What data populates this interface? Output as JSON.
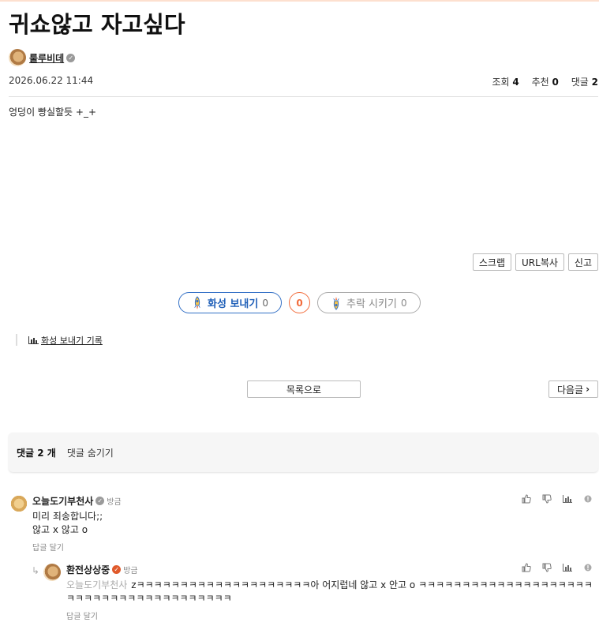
{
  "post": {
    "title": "귀쇼않고 자고싶다",
    "author": "룰루비데",
    "date": "2026.06.22 11:44",
    "stats": {
      "views_label": "조회",
      "views": "4",
      "recommend_label": "추천",
      "recommend": "0",
      "comments_label": "댓글",
      "comments": "2"
    },
    "body": "엉덩이 빵실할듯 +_+"
  },
  "tools": {
    "scrap": "스크랩",
    "copy_url": "URL복사",
    "report": "신고"
  },
  "vote": {
    "up_label": "화성 보내기",
    "up_count": "0",
    "score": "0",
    "down_label": "추락 시키기",
    "down_count": "0",
    "history_label": "화성 보내기 기록"
  },
  "nav": {
    "list_label": "목록으로",
    "next_label": "다음글"
  },
  "comment_bar": {
    "count_label": "댓글 2 개",
    "hide_label": "댓글 숨기기"
  },
  "comments": [
    {
      "author": "오늘도기부천사",
      "time": "방금",
      "lines": [
        "미리 죄송합니다;;",
        "않고 x 않고 o"
      ],
      "reply_label": "답글 달기"
    },
    {
      "author": "환전상상중",
      "time": "방금",
      "mention": "오늘도기부천사",
      "text": "zㅋㅋㅋㅋㅋㅋㅋㅋㅋㅋㅋㅋㅋㅋㅋㅋㅋㅋㅋㅋ아 어지럽네 않고 x 안고 o ㅋㅋㅋㅋㅋㅋㅋㅋㅋㅋㅋㅋㅋㅋㅋㅋㅋㅋㅋㅋㅋㅋㅋㅋㅋㅋㅋㅋㅋㅋㅋㅋㅋㅋㅋㅋㅋㅋㅋ",
      "reply_label": "답글 달기"
    }
  ],
  "colors": {
    "accent_blue": "#1f5fb8",
    "accent_orange": "#f26b3a"
  }
}
